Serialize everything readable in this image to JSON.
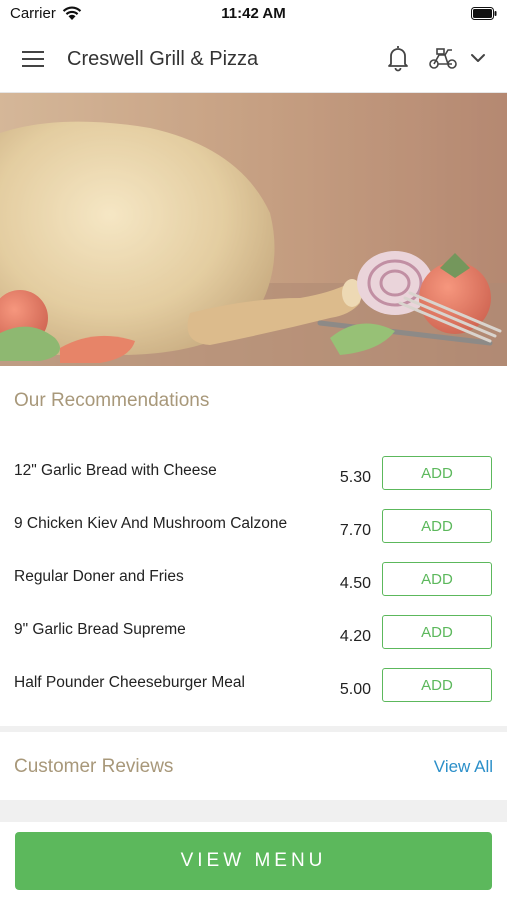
{
  "status_bar": {
    "carrier": "Carrier",
    "time": "11:42 AM"
  },
  "nav": {
    "title": "Creswell Grill & Pizza"
  },
  "recommendations": {
    "heading": "Our Recommendations",
    "items": [
      {
        "name": "12\" Garlic Bread with Cheese",
        "price": "5.30",
        "add_label": "ADD"
      },
      {
        "name": "9 Chicken Kiev And Mushroom Calzone",
        "price": "7.70",
        "add_label": "ADD"
      },
      {
        "name": "Regular Doner and Fries",
        "price": "4.50",
        "add_label": "ADD"
      },
      {
        "name": "9\" Garlic Bread Supreme",
        "price": "4.20",
        "add_label": "ADD"
      },
      {
        "name": "Half Pounder Cheeseburger Meal",
        "price": "5.00",
        "add_label": "ADD"
      }
    ]
  },
  "reviews": {
    "heading": "Customer Reviews",
    "view_all": "View All"
  },
  "footer": {
    "view_menu_label": "VIEW MENU"
  },
  "colors": {
    "accent_green": "#5cb85c",
    "heading_tan": "#a8987a",
    "link_blue": "#2b8fc9"
  },
  "icons": [
    "wifi-icon",
    "battery-icon",
    "menu-icon",
    "bell-icon",
    "delivery-icon",
    "chevron-down-icon"
  ]
}
